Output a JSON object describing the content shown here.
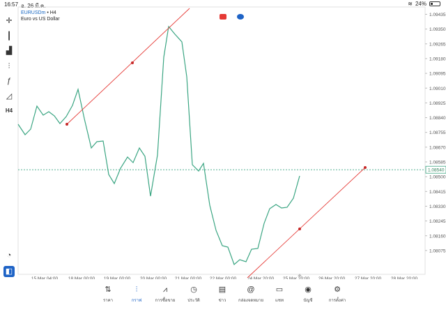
{
  "status": {
    "time": "16:57",
    "date": "อ. 26 มี.ค.",
    "battery": "24%",
    "battery_level": 0.24
  },
  "chart": {
    "symbol": "EURUSDm",
    "timeframe": "H4",
    "description": "Euro vs US Dollar",
    "price_label": "1.08540",
    "accent": "#1e63c6",
    "line_color": "#3aa582",
    "trendline_color": "#e53935",
    "price_ticks": [
      "1.09435",
      "1.09350",
      "1.09265",
      "1.09180",
      "1.09095",
      "1.09010",
      "1.08925",
      "1.08840",
      "1.08755",
      "1.08670",
      "1.08585",
      "1.08500",
      "1.08415",
      "1.08330",
      "1.08245",
      "1.08160",
      "1.08075"
    ],
    "time_ticks": [
      "15 Mar 04:00",
      "18 Mar 00:00",
      "19 Mar 00:00",
      "20 Mar 00:00",
      "21 Mar 00:00",
      "22 Mar 00:00",
      "24 Mar 20:00",
      "25 Mar 20:00",
      "26 Mar 20:00",
      "27 Mar 20:00",
      "28 Mar 20:00"
    ]
  },
  "toolbar": [
    {
      "name": "crosshair-icon",
      "glyph": "✛"
    },
    {
      "name": "candlestick-icon",
      "glyph": "┃"
    },
    {
      "name": "bar-chart-icon",
      "glyph": "▟"
    },
    {
      "name": "indicators-icon",
      "glyph": "⫶"
    },
    {
      "name": "function-icon",
      "glyph": "ƒ"
    },
    {
      "name": "objects-icon",
      "glyph": "◿"
    },
    {
      "name": "timeframe-label",
      "glyph": "H4"
    }
  ],
  "nav": [
    {
      "label": "ราคา",
      "icon": "⇅"
    },
    {
      "label": "กราฟ",
      "icon": "⫶"
    },
    {
      "label": "การซื้อขาย",
      "icon": "⩘"
    },
    {
      "label": "ประวัติ",
      "icon": "◷"
    },
    {
      "label": "ข่าว",
      "icon": "▤"
    },
    {
      "label": "กล่องจดหมาย",
      "icon": "@"
    },
    {
      "label": "แชท",
      "icon": "▭"
    },
    {
      "label": "บัญชี",
      "icon": "◉"
    },
    {
      "label": "การตั้งค่า",
      "icon": "⚙"
    }
  ]
}
